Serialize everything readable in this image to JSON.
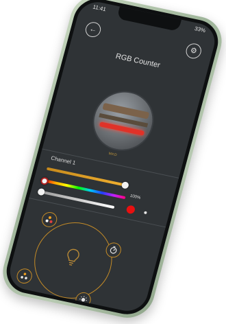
{
  "status": {
    "time": "11:41",
    "battery": "33%"
  },
  "header": {
    "title": "RGB Counter",
    "back_icon": "arrow-left-icon",
    "settings_icon": "gear-icon"
  },
  "preview": {
    "caption": "MKD"
  },
  "channel": {
    "label": "Channel 1",
    "brightness_percent_label": "100%",
    "brightness": 1.0,
    "selected_color": "#e81010"
  },
  "colors": {
    "accent": "#c48b27",
    "background": "#2f3336",
    "frame": "#a9bfa3"
  },
  "controls": {
    "top_left": "rgb-dots-icon",
    "top_right": "timer-icon",
    "center": "lightbulb-icon",
    "bottom_left": "palette-dots-icon",
    "bottom_right": "sun-icon"
  }
}
